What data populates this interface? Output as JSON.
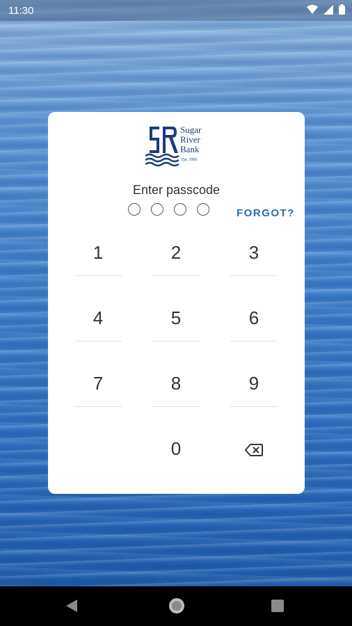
{
  "status_bar": {
    "time": "11:30",
    "icons": [
      "wifi-icon",
      "signal-icon",
      "battery-icon"
    ]
  },
  "logo": {
    "line1": "Sugar",
    "line2": "River",
    "line3": "Bank",
    "est": "Est. 1995"
  },
  "prompt": "Enter passcode",
  "passcode_length": 4,
  "forgot_label": "FORGOT?",
  "keypad": [
    "1",
    "2",
    "3",
    "4",
    "5",
    "6",
    "7",
    "8",
    "9",
    "0"
  ],
  "colors": {
    "accent": "#2f6aa8",
    "brand": "#1b3d7a"
  }
}
